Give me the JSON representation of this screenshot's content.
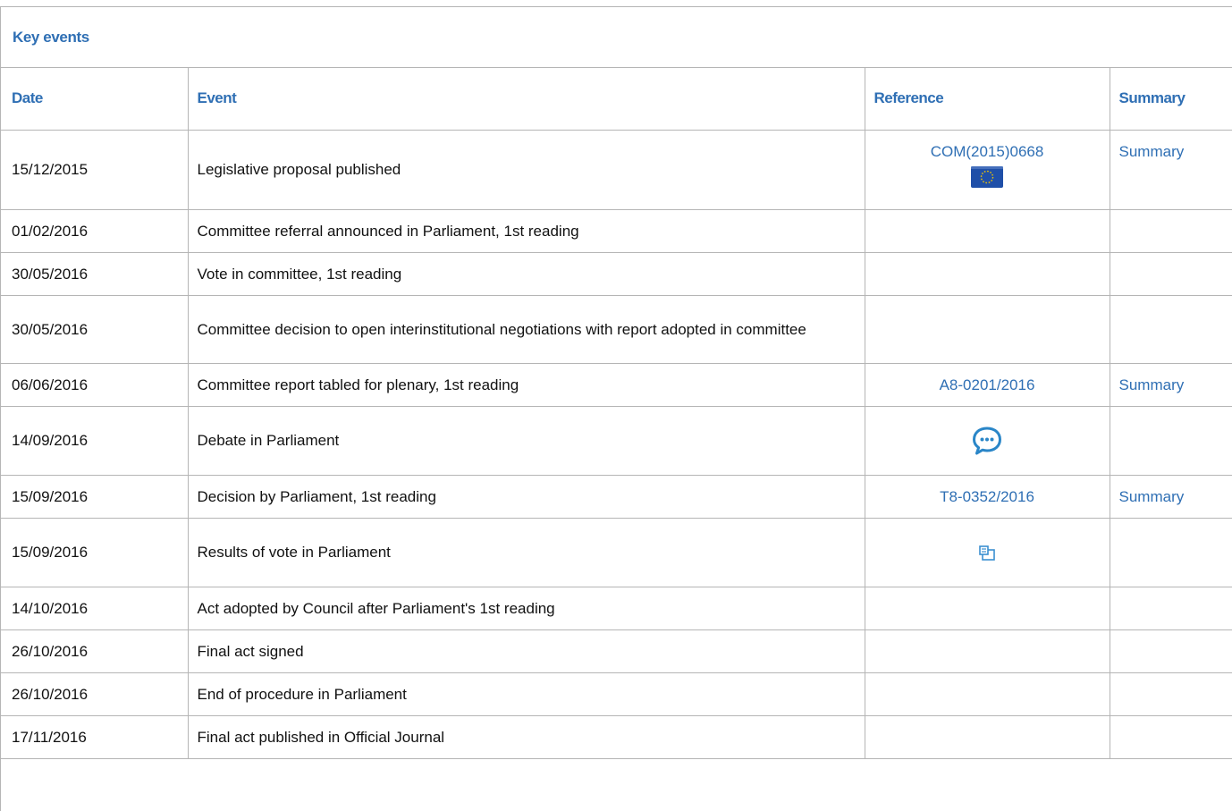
{
  "panel": {
    "title": "Key events"
  },
  "columns": {
    "date": "Date",
    "event": "Event",
    "reference": "Reference",
    "summary": "Summary"
  },
  "rows": [
    {
      "date": "15/12/2015",
      "event": "Legislative proposal published",
      "reference": "COM(2015)0668",
      "reference_icon": "eu-flag-icon",
      "summary": "Summary"
    },
    {
      "date": "01/02/2016",
      "event": "Committee referral announced in Parliament, 1st reading",
      "reference": "",
      "summary": ""
    },
    {
      "date": "30/05/2016",
      "event": "Vote in committee, 1st reading",
      "reference": "",
      "summary": ""
    },
    {
      "date": "30/05/2016",
      "event": "Committee decision to open interinstitutional negotiations with report adopted in committee",
      "reference": "",
      "summary": ""
    },
    {
      "date": "06/06/2016",
      "event": "Committee report tabled for plenary, 1st reading",
      "reference": "A8-0201/2016",
      "summary": "Summary"
    },
    {
      "date": "14/09/2016",
      "event": "Debate in Parliament",
      "reference": "",
      "reference_icon": "speech-bubble-icon",
      "summary": ""
    },
    {
      "date": "15/09/2016",
      "event": "Decision by Parliament, 1st reading",
      "reference": "T8-0352/2016",
      "summary": "Summary"
    },
    {
      "date": "15/09/2016",
      "event": "Results of vote in Parliament",
      "reference": "",
      "reference_icon": "vote-results-icon",
      "summary": ""
    },
    {
      "date": "14/10/2016",
      "event": "Act adopted by Council after Parliament's 1st reading",
      "reference": "",
      "summary": ""
    },
    {
      "date": "26/10/2016",
      "event": "Final act signed",
      "reference": "",
      "summary": ""
    },
    {
      "date": "26/10/2016",
      "event": "End of procedure in Parliament",
      "reference": "",
      "summary": ""
    },
    {
      "date": "17/11/2016",
      "event": "Final act published in Official Journal",
      "reference": "",
      "summary": ""
    }
  ],
  "colors": {
    "link": "#2f6fb4",
    "border": "#b5b5b5",
    "eu_flag_blue": "#1f4fa8",
    "eu_flag_star": "#f2c500"
  }
}
